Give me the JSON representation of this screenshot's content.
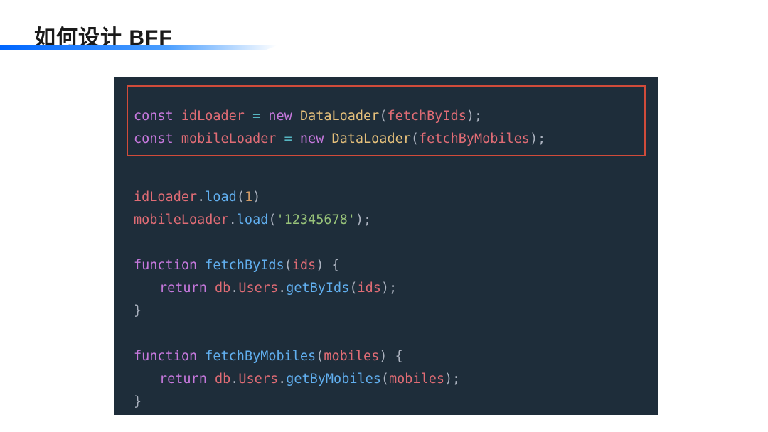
{
  "title": "如何设计 BFF",
  "code": {
    "line1": {
      "kw1": "const",
      "var": "idLoader",
      "op": "=",
      "kw2": "new",
      "cls": "DataLoader",
      "lp": "(",
      "arg": "fetchByIds",
      "rp": ")",
      "sc": ";"
    },
    "line2": {
      "kw1": "const",
      "var": "mobileLoader",
      "op": "=",
      "kw2": "new",
      "cls": "DataLoader",
      "lp": "(",
      "arg": "fetchByMobiles",
      "rp": ")",
      "sc": ";"
    },
    "line3": {
      "obj": "idLoader",
      "dot": ".",
      "fn": "load",
      "lp": "(",
      "arg": "1",
      "rp": ")"
    },
    "line4": {
      "obj": "mobileLoader",
      "dot": ".",
      "fn": "load",
      "lp": "(",
      "arg": "'12345678'",
      "rp": ")",
      "sc": ";"
    },
    "line5": {
      "kw": "function",
      "name": "fetchByIds",
      "lp": "(",
      "param": "ids",
      "rp": ")",
      "brace": "{"
    },
    "line6": {
      "kw": "return",
      "obj1": "db",
      "d1": ".",
      "obj2": "Users",
      "d2": ".",
      "fn": "getByIds",
      "lp": "(",
      "arg": "ids",
      "rp": ")",
      "sc": ";"
    },
    "line7": {
      "brace": "}"
    },
    "line8": {
      "kw": "function",
      "name": "fetchByMobiles",
      "lp": "(",
      "param": "mobiles",
      "rp": ")",
      "brace": "{"
    },
    "line9": {
      "kw": "return",
      "obj1": "db",
      "d1": ".",
      "obj2": "Users",
      "d2": ".",
      "fn": "getByMobiles",
      "lp": "(",
      "arg": "mobiles",
      "rp": ")",
      "sc": ";"
    },
    "line10": {
      "brace": "}"
    }
  }
}
